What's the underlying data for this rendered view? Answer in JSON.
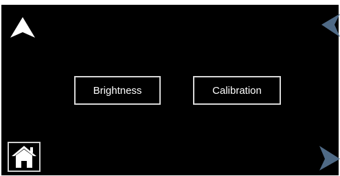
{
  "screen": {
    "background_color": "#000000",
    "accent_color": "#ffffff",
    "arrow_color": "#4f6a86"
  },
  "menu": {
    "buttons": [
      {
        "label": "Brightness"
      },
      {
        "label": "Calibration"
      }
    ]
  },
  "navigation": {
    "up_icon": "arrow-up-icon",
    "back_icon": "arrow-left-icon",
    "forward_icon": "arrow-right-icon",
    "home_icon": "home-icon"
  }
}
